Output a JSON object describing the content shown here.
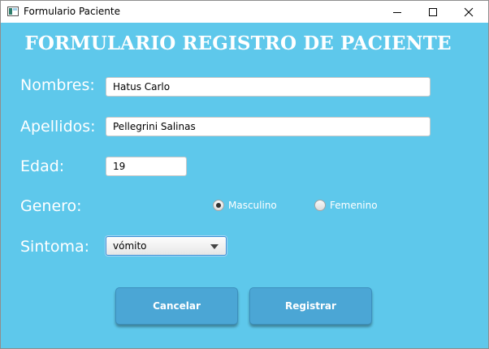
{
  "window": {
    "title": "Formulario Paciente",
    "controls": [
      "minimize-icon",
      "maximize-icon",
      "close-icon"
    ]
  },
  "form": {
    "heading": "FORMULARIO REGISTRO DE PACIENTE",
    "nombres": {
      "label": "Nombres:",
      "value": "Hatus Carlo"
    },
    "apellidos": {
      "label": "Apellidos:",
      "value": "Pellegrini Salinas"
    },
    "edad": {
      "label": "Edad:",
      "value": "19"
    },
    "genero": {
      "label": "Genero:",
      "options": [
        {
          "label": "Masculino",
          "selected": true
        },
        {
          "label": "Femenino",
          "selected": false
        }
      ]
    },
    "sintoma": {
      "label": "Sintoma:",
      "value": "vómito"
    }
  },
  "actions": {
    "cancel_label": "Cancelar",
    "register_label": "Registrar"
  },
  "colors": {
    "background": "#5ec8eb",
    "button": "#4ba6d5",
    "text": "#ffffff"
  }
}
